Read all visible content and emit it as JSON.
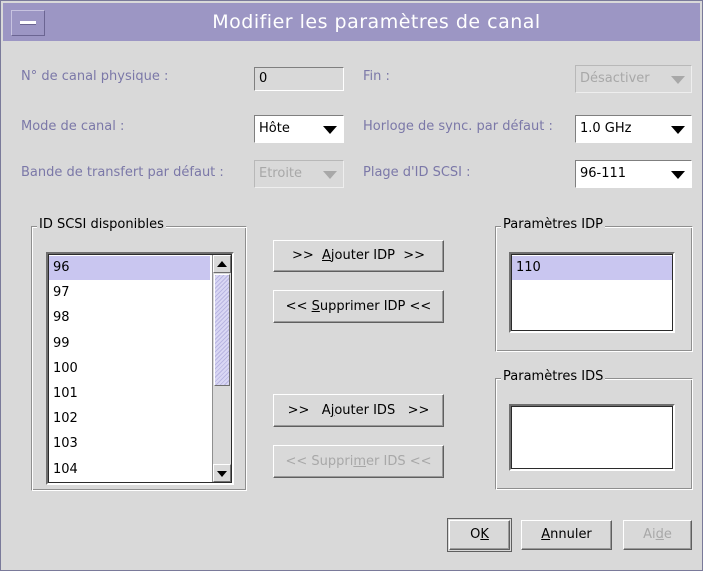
{
  "window": {
    "title": "Modifier les paramètres de canal"
  },
  "form": {
    "physical_channel": {
      "label": "N° de canal physique :",
      "value": "0"
    },
    "end": {
      "label": "Fin :",
      "value": "Désactiver"
    },
    "channel_mode": {
      "label": "Mode de canal :",
      "value": "Hôte"
    },
    "default_sync_clock": {
      "label": "Horloge de sync. par défaut :",
      "value": "1.0 GHz"
    },
    "default_transfer_band": {
      "label": "Bande de transfert par défaut :",
      "value": "Etroite"
    },
    "scsi_id_range": {
      "label": "Plage d'ID SCSI :",
      "value": "96-111"
    }
  },
  "available_ids": {
    "title": "ID SCSI disponibles",
    "items": [
      "96",
      "97",
      "98",
      "99",
      "100",
      "101",
      "102",
      "103",
      "104"
    ],
    "selected": "96"
  },
  "idp_params": {
    "title": "Paramètres IDP",
    "items": [
      "110"
    ]
  },
  "ids_params": {
    "title": "Paramètres IDS",
    "items": []
  },
  "buttons": {
    "add_idp": {
      "pre": ">>  ",
      "mnemonic": "A",
      "post": "jouter IDP  >>"
    },
    "remove_idp": {
      "pre": "<< ",
      "mnemonic": "S",
      "post": "upprimer IDP <<"
    },
    "add_ids": {
      "pre": ">>   A",
      "mnemonic": "j",
      "post": "outer IDS   >>"
    },
    "remove_ids": {
      "pre": "<< Suppri",
      "mnemonic": "m",
      "post": "er IDS <<"
    },
    "ok": {
      "pre": "O",
      "mnemonic": "K",
      "post": ""
    },
    "cancel": {
      "pre": "",
      "mnemonic": "A",
      "post": "nnuler"
    },
    "help": {
      "pre": "Ai",
      "mnemonic": "d",
      "post": "e"
    }
  },
  "colors": {
    "titlebar": "#9c96c4",
    "dialog_bg": "#d9d9d9",
    "disabled_label": "#7b78a8",
    "selection": "#c9c6f0"
  }
}
